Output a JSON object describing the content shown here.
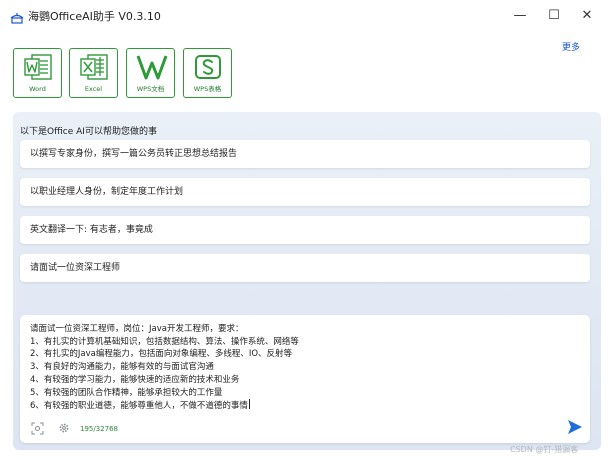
{
  "window": {
    "title": "海鹦OfficeAI助手 V0.3.10",
    "minimize_glyph": "—",
    "maximize_glyph": "☐",
    "close_glyph": "✕"
  },
  "header": {
    "more_link": "更多"
  },
  "apps": [
    {
      "label": "Word",
      "icon": "word-icon"
    },
    {
      "label": "Excel",
      "icon": "excel-icon"
    },
    {
      "label": "WPS文档",
      "icon": "wps-doc-icon"
    },
    {
      "label": "WPS表格",
      "icon": "wps-sheet-icon"
    }
  ],
  "main": {
    "section_title": "以下是Office AI可以帮助您做的事",
    "suggestions": [
      "以撰写专家身份，撰写一篇公务员转正思想总结报告",
      "以职业经理人身份，制定年度工作计划",
      "英文翻译一下: 有志者，事竟成",
      "请面试一位资深工程师"
    ]
  },
  "input": {
    "lines": [
      "请面试一位资深工程师，岗位：Java开发工程师，要求：",
      "1、有扎实的计算机基础知识，包括数据结构、算法、操作系统、网络等",
      "2、有扎实的Java编程能力，包括面向对象编程、多线程、IO、反射等",
      "3、有良好的沟通能力，能够有效的与面试官沟通",
      "4、有较强的学习能力，能够快速的适应新的技术和业务",
      "5、有较强的团队合作精神，能够承担较大的工作量",
      "6、有较强的职业道德，能够尊重他人，不做不道德的事情"
    ],
    "char_count": "195/32768"
  },
  "watermark": "CSDN @钉-猎漏客",
  "colors": {
    "accent_green": "#2e9a38",
    "link_blue": "#1a55d6",
    "send_blue": "#1e6fd9",
    "panel_bg": "#e3eaf4"
  }
}
